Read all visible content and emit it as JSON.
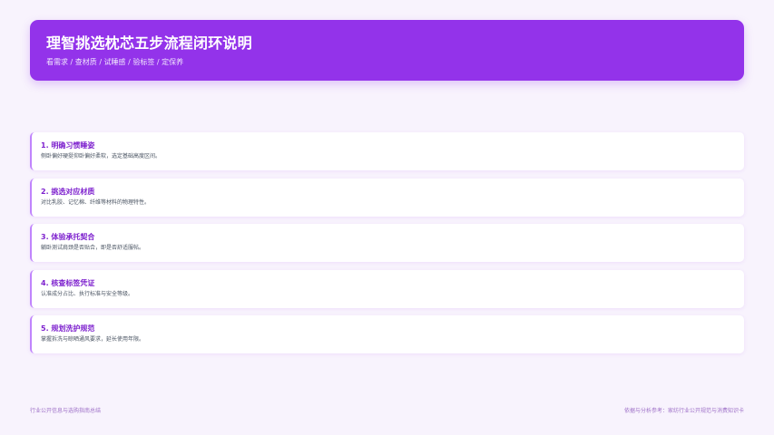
{
  "header": {
    "title": "理智挑选枕芯五步流程闭环说明",
    "subtitle": "看需求 / 查材质 / 试睡感 / 验标签 / 定保养"
  },
  "steps": [
    {
      "title": "1. 明确习惯睡姿",
      "desc": "侧卧偏好硬挺仰卧偏好柔软，选定基础高度区间。"
    },
    {
      "title": "2. 挑选对应材质",
      "desc": "对比乳胶、记忆棉、纤维等材料的物理特性。"
    },
    {
      "title": "3. 体验承托契合",
      "desc": "躺卧测试肩颈是否贴合，即是否舒适服帖。"
    },
    {
      "title": "4. 核查标签凭证",
      "desc": "认准成分占比、执行标准与安全等级。"
    },
    {
      "title": "5. 规划洗护规范",
      "desc": "掌握拆洗与晾晒通风要求，延长使用年限。"
    }
  ],
  "footer": {
    "left": "行业公开信息与选购指南总结",
    "right": "依据与分析参考：家纺行业公开规范与消费知识卡"
  },
  "colors": {
    "accent": "#9333ea",
    "step_title": "#7e22ce",
    "page_background": "#f8f3fd"
  }
}
